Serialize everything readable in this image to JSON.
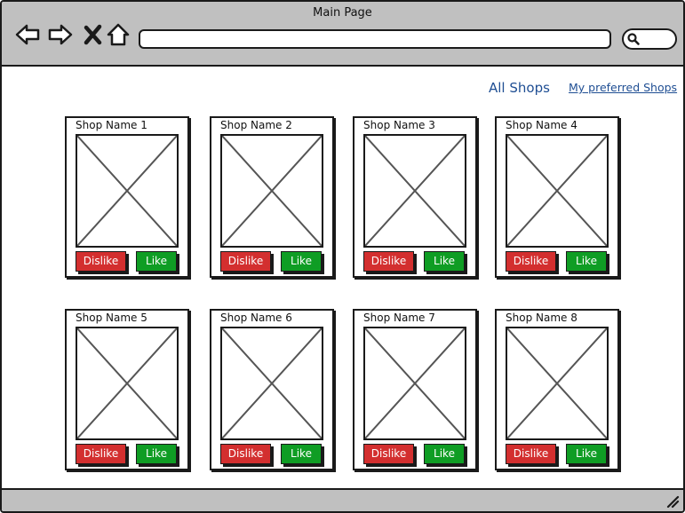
{
  "window": {
    "title": "Main Page"
  },
  "tabs": {
    "all_shops": "All Shops",
    "preferred_shops": "My preferred Shops"
  },
  "shops": [
    {
      "name": "Shop Name 1",
      "dislike": "Dislike",
      "like": "Like"
    },
    {
      "name": "Shop Name 2",
      "dislike": "Dislike",
      "like": "Like"
    },
    {
      "name": "Shop Name 3",
      "dislike": "Dislike",
      "like": "Like"
    },
    {
      "name": "Shop Name 4",
      "dislike": "Dislike",
      "like": "Like"
    },
    {
      "name": "Shop Name 5",
      "dislike": "Dislike",
      "like": "Like"
    },
    {
      "name": "Shop Name 6",
      "dislike": "Dislike",
      "like": "Like"
    },
    {
      "name": "Shop Name 7",
      "dislike": "Dislike",
      "like": "Like"
    },
    {
      "name": "Shop Name 8",
      "dislike": "Dislike",
      "like": "Like"
    }
  ],
  "colors": {
    "chrome": "#c0c0c0",
    "link": "#1f4e93",
    "dislike": "#d32f2f",
    "like": "#0f9d24"
  },
  "icons": [
    "back-arrow-icon",
    "forward-arrow-icon",
    "close-icon",
    "home-icon",
    "search-icon",
    "resize-grip-icon"
  ]
}
